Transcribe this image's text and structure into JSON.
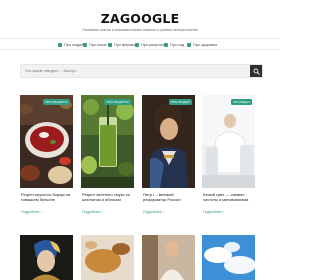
{
  "site": {
    "logo": "ZAGOOGLE",
    "tagline": "Полезные статьи и познавательные новости о разных интересностях"
  },
  "nav": {
    "items": [
      {
        "label": "Про людей"
      },
      {
        "label": "Про котов"
      },
      {
        "label": "Про фермы"
      },
      {
        "label": "Про рецепты"
      },
      {
        "label": "Про сад"
      },
      {
        "label": "Про здоровье"
      }
    ]
  },
  "search": {
    "placeholder": "Что ищем, введите… Быстро"
  },
  "cards": [
    {
      "badge": "ПРО РЕЦЕПТЫ",
      "title": "Рецепт вкусного борща на говяжьем бульоне",
      "more": "Подробнее"
    },
    {
      "badge": "ПРО РЕЦЕПТЫ",
      "title": "Рецепт зеленого смузи со шпинатом и яблоком",
      "more": "Подробнее"
    },
    {
      "badge": "ПРО ЛЮДЕЙ",
      "title": "Петр I – великий реформатор России",
      "more": "Подробнее"
    },
    {
      "badge": "ПРО ВЕЩИ",
      "title": "Белый цвет — символ чистоты и минимализма",
      "more": "Подробнее"
    }
  ],
  "colors": {
    "accent": "#2f9e83",
    "search_button": "#2e2e2e"
  },
  "icons": {
    "search": "search-icon"
  }
}
